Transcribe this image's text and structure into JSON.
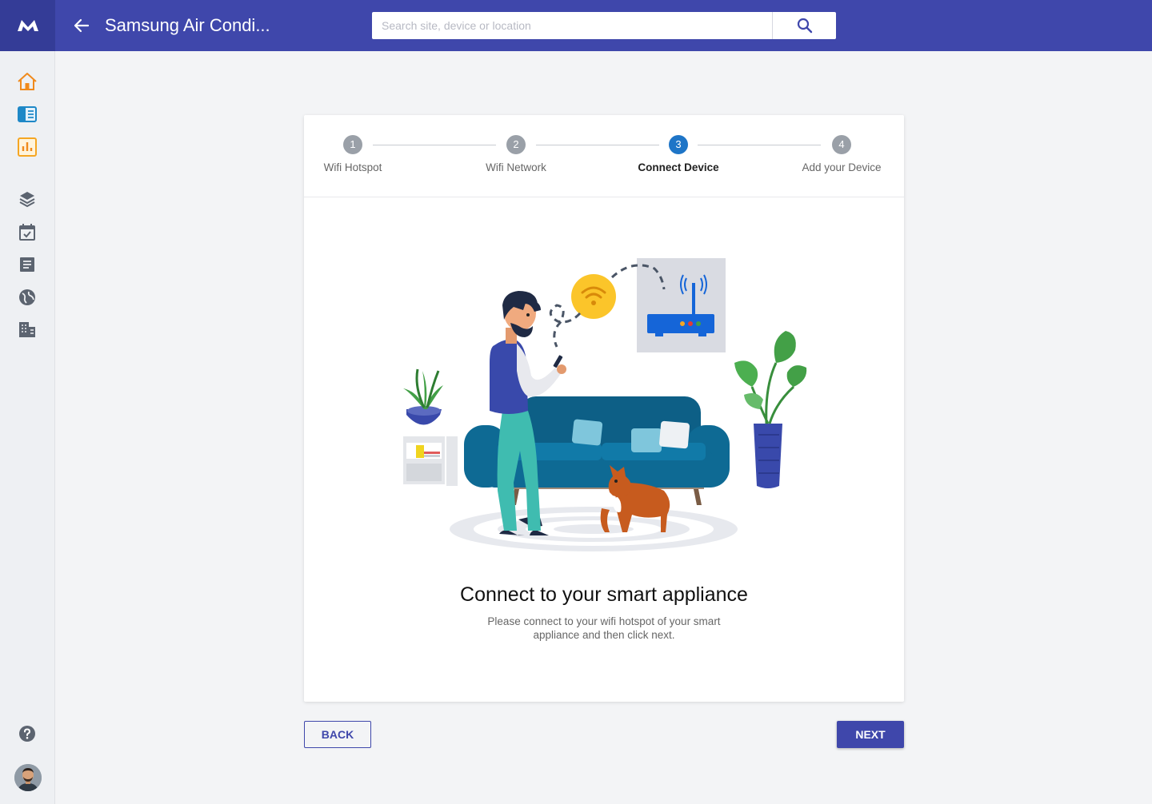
{
  "header": {
    "title": "Samsung Air Condi...",
    "search_placeholder": "Search site, device or location",
    "search_value": ""
  },
  "sidebar": {
    "items": [
      {
        "icon": "home-icon"
      },
      {
        "icon": "device-list-icon"
      },
      {
        "icon": "bar-chart-icon"
      },
      {
        "icon": "layers-icon"
      },
      {
        "icon": "calendar-check-icon"
      },
      {
        "icon": "document-icon"
      },
      {
        "icon": "globe-icon"
      },
      {
        "icon": "building-icon"
      },
      {
        "icon": "help-icon"
      },
      {
        "icon": "user-avatar"
      }
    ]
  },
  "stepper": {
    "active_step": 3,
    "steps": [
      {
        "number": "1",
        "label": "Wifi Hotspot"
      },
      {
        "number": "2",
        "label": "Wifi Network"
      },
      {
        "number": "3",
        "label": "Connect Device"
      },
      {
        "number": "4",
        "label": "Add your Device"
      }
    ]
  },
  "content": {
    "title": "Connect to your smart appliance",
    "subtitle": "Please connect to your wifi hotspot of your smart appliance and then click next."
  },
  "buttons": {
    "back": "BACK",
    "next": "NEXT"
  },
  "colors": {
    "primary": "#3f47ab",
    "step_active": "#1e75c7",
    "step_inactive": "#9aa0a8",
    "accent_orange": "#f08a1c"
  }
}
